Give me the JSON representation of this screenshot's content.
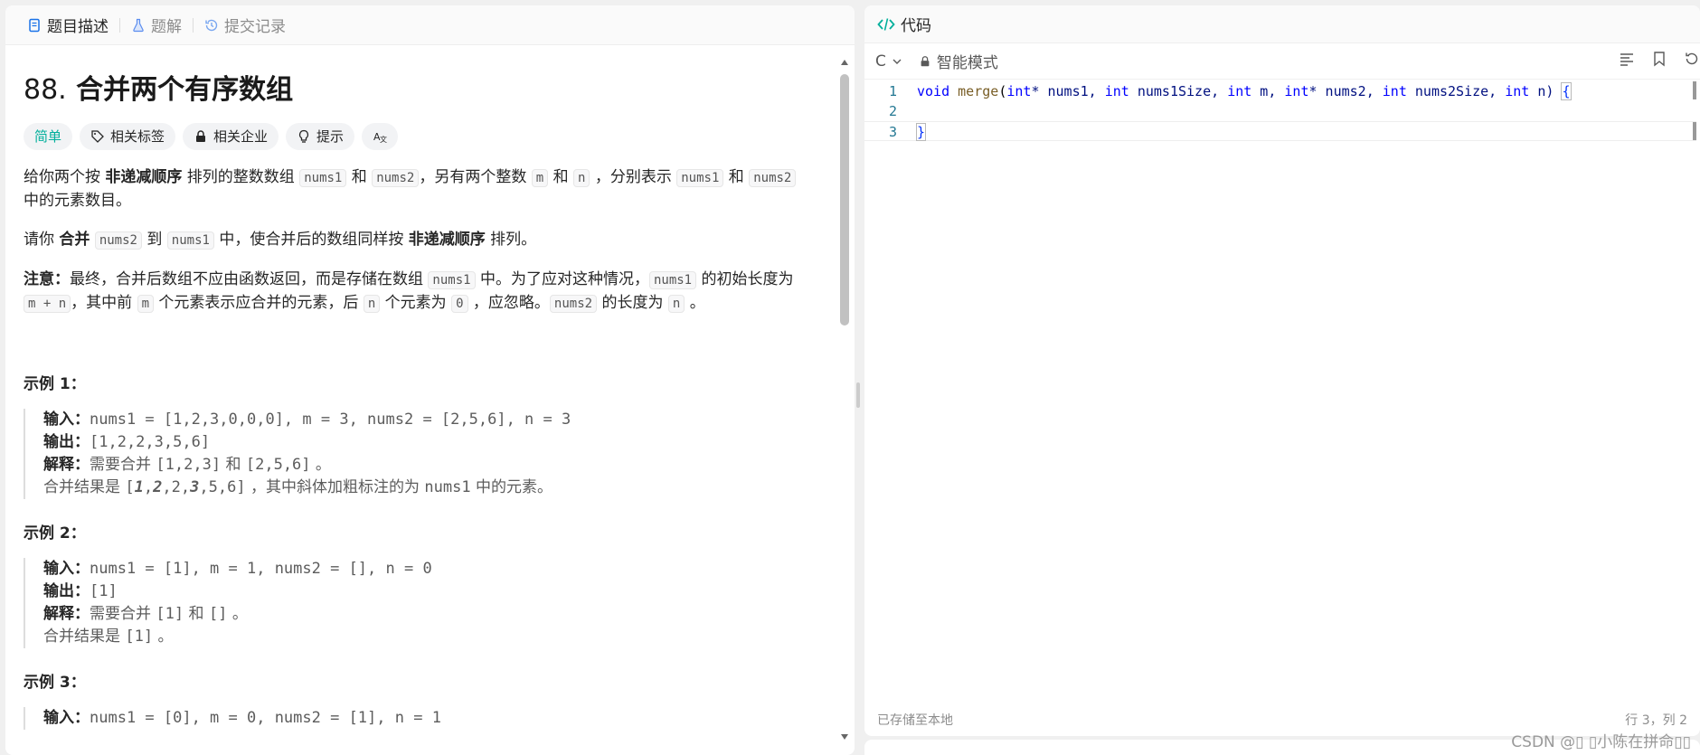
{
  "left_tabs": {
    "description": "题目描述",
    "solutions": "题解",
    "submissions": "提交记录"
  },
  "problem": {
    "number": "88.",
    "title": "合并两个有序数组",
    "difficulty": "简单",
    "tags": {
      "related_tags": "相关标签",
      "companies": "相关企业",
      "hints": "提示"
    }
  },
  "description": {
    "p1": {
      "a": "给你两个按 ",
      "b": "非递减顺序",
      "c": " 排列的整数数组 ",
      "code1": "nums1",
      "d": " 和 ",
      "code2": "nums2",
      "e": "，另有两个整数 ",
      "code3": "m",
      "f": " 和 ",
      "code4": "n",
      "g": " ，分别表示 ",
      "code5": "nums1",
      "h": " 和 ",
      "code6": "nums2",
      "i": " 中的元素数目。"
    },
    "p2": {
      "a": "请你 ",
      "b": "合并",
      "c": " ",
      "code1": "nums2",
      "d": " 到 ",
      "code2": "nums1",
      "e": " 中，使合并后的数组同样按 ",
      "f": "非递减顺序",
      "g": " 排列。"
    },
    "p3": {
      "a": "注意：",
      "b": "最终，合并后数组不应由函数返回，而是存储在数组 ",
      "code1": "nums1",
      "c": " 中。为了应对这种情况，",
      "code2": "nums1",
      "d": " 的初始长度为 ",
      "code3": "m + n",
      "e": "，其中前 ",
      "code4": "m",
      "f": " 个元素表示应合并的元素，后 ",
      "code5": "n",
      "g": " 个元素为 ",
      "code6": "0",
      "h": " ，应忽略。",
      "code7": "nums2",
      "i": " 的长度为 ",
      "code8": "n",
      "j": " 。"
    }
  },
  "examples": [
    {
      "title": "示例 1：",
      "input_label": "输入：",
      "input": "nums1 = [1,2,3,0,0,0], m = 3, nums2 = [2,5,6], n = 3",
      "output_label": "输出：",
      "output": "[1,2,2,3,5,6]",
      "explain_label": "解释：",
      "explain_a": "需要合并 ",
      "explain_b": "[1,2,3]",
      "explain_c": " 和 ",
      "explain_d": "[2,5,6]",
      "explain_e": " 。",
      "result_a": "合并结果是 ",
      "result_open": "[",
      "r1": "1",
      "r_c1": ",",
      "r2": "2",
      "r_rest1": ",2,",
      "r3": "3",
      "r_rest2": ",5,6]",
      "result_b": " ，其中斜体加粗标注的为 ",
      "result_c": "nums1",
      "result_d": " 中的元素。"
    },
    {
      "title": "示例 2：",
      "input_label": "输入：",
      "input": "nums1 = [1], m = 1, nums2 = [], n = 0",
      "output_label": "输出：",
      "output": "[1]",
      "explain_label": "解释：",
      "explain_a": "需要合并 ",
      "explain_b": "[1]",
      "explain_c": " 和 ",
      "explain_d": "[]",
      "explain_e": " 。",
      "result_a": "合并结果是 ",
      "result_b": "[1]",
      "result_c": " 。"
    },
    {
      "title": "示例 3：",
      "input_label": "输入：",
      "input": "nums1 = [0], m = 0, nums2 = [1], n = 1"
    }
  ],
  "right": {
    "tab": "代码",
    "language": "C",
    "mode": "智能模式",
    "code": {
      "l1_num": "1",
      "l2_num": "2",
      "l3_num": "3",
      "void": "void",
      "fn": "merge",
      "lp": "(",
      "int1": "int",
      "p1": "* nums1, ",
      "int2": "int",
      "p2": " nums1Size, ",
      "int3": "int",
      "p3": " m, ",
      "int4": "int",
      "p4": "* nums2, ",
      "int5": "int",
      "p5": " nums2Size, ",
      "int6": "int",
      "p6": " n) ",
      "open_brace": "{",
      "close_brace": "}"
    },
    "status_left": "已存储至本地",
    "status_right": "行 3，列 2"
  },
  "watermark": "CSDN @▯ ▯小陈在拼命▯▯"
}
